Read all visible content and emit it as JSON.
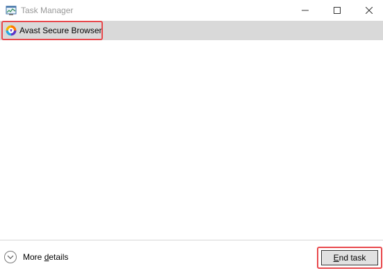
{
  "window": {
    "title": "Task Manager"
  },
  "process_list": {
    "rows": [
      {
        "name": "Avast Secure Browser",
        "icon": "avast-browser-icon",
        "selected": true
      }
    ]
  },
  "footer": {
    "more_details_prefix": "More ",
    "more_details_accel": "d",
    "more_details_suffix": "etails",
    "end_task_accel": "E",
    "end_task_suffix": "nd task"
  },
  "colors": {
    "selected_row": "#d9d9d9",
    "highlight_box": "#e8474b",
    "title_text": "#999999",
    "button_face": "#e1e1e1"
  }
}
